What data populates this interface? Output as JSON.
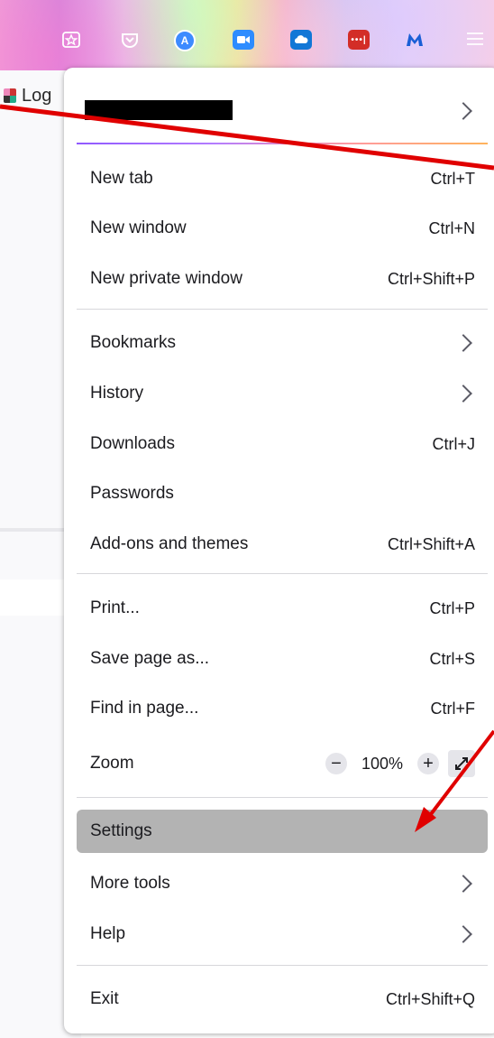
{
  "page": {
    "tab_label": "Log"
  },
  "toolbar": {
    "icons": [
      {
        "name": "extension-star-icon",
        "color": "#ffffff"
      },
      {
        "name": "pocket-icon",
        "color": "#ffffff"
      },
      {
        "name": "avatar-a-icon",
        "color": "#3d8bff"
      },
      {
        "name": "zoom-video-icon",
        "color": "#2d8cff"
      },
      {
        "name": "onedrive-cloud-icon",
        "color": "#1277d6"
      },
      {
        "name": "lastpass-icon",
        "color": "#d32d27"
      },
      {
        "name": "malwarebytes-icon",
        "color": "#1a7ad6"
      },
      {
        "name": "app-menu-icon",
        "color": "#ffffff"
      }
    ]
  },
  "menu": {
    "account_chevron": ">",
    "items": [
      {
        "label": "New tab",
        "shortcut": "Ctrl+T"
      },
      {
        "label": "New window",
        "shortcut": "Ctrl+N"
      },
      {
        "label": "New private window",
        "shortcut": "Ctrl+Shift+P"
      },
      {
        "label": "Bookmarks",
        "shortcut": ""
      },
      {
        "label": "History",
        "shortcut": ""
      },
      {
        "label": "Downloads",
        "shortcut": "Ctrl+J"
      },
      {
        "label": "Passwords",
        "shortcut": ""
      },
      {
        "label": "Add-ons and themes",
        "shortcut": "Ctrl+Shift+A"
      },
      {
        "label": "Print...",
        "shortcut": "Ctrl+P"
      },
      {
        "label": "Save page as...",
        "shortcut": "Ctrl+S"
      },
      {
        "label": "Find in page...",
        "shortcut": "Ctrl+F"
      },
      {
        "label": "Zoom",
        "shortcut": ""
      },
      {
        "label": "Settings",
        "shortcut": ""
      },
      {
        "label": "More tools",
        "shortcut": ""
      },
      {
        "label": "Help",
        "shortcut": ""
      },
      {
        "label": "Exit",
        "shortcut": "Ctrl+Shift+Q"
      }
    ],
    "zoom": {
      "minus": "−",
      "value": "100%",
      "plus": "+"
    }
  },
  "colors": {
    "highlight": "#b3b3b3",
    "annotation": "#e00000",
    "separator": "#d7d7db"
  }
}
